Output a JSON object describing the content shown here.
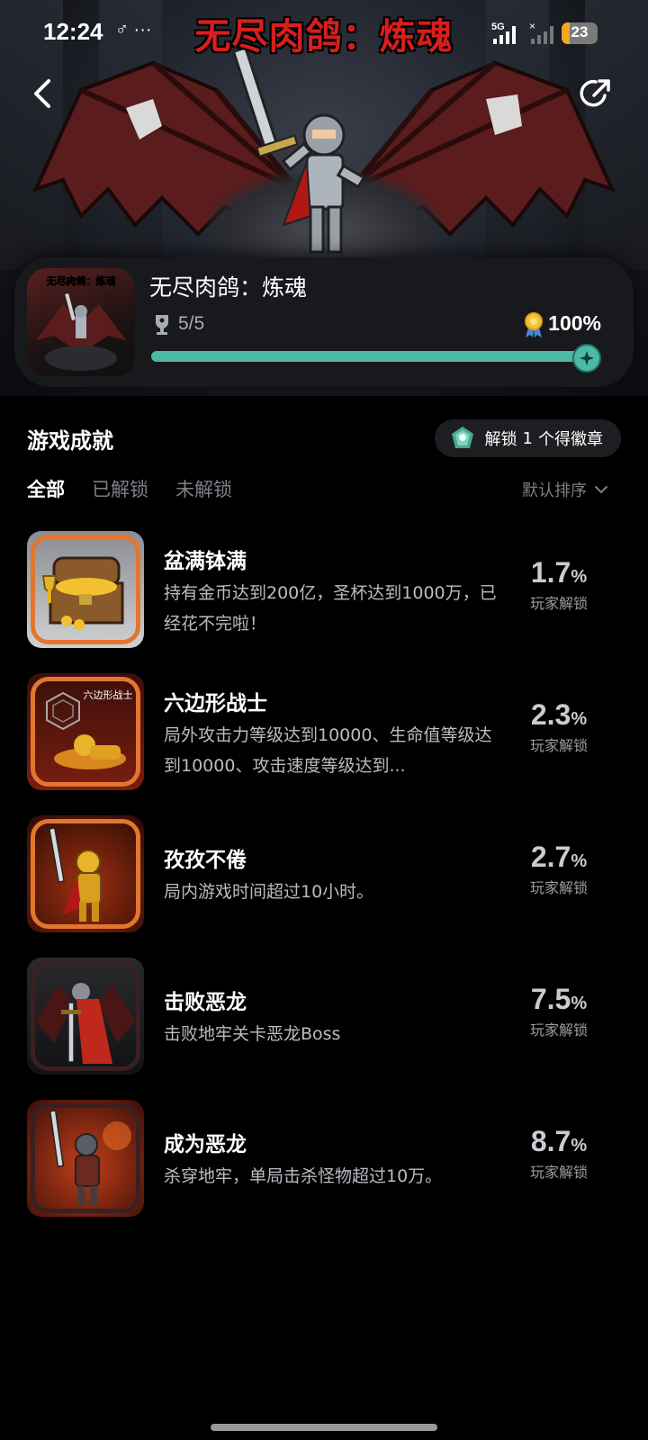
{
  "status_bar": {
    "time": "12:24",
    "extra": "♂ ···",
    "network": "5G",
    "battery": "23"
  },
  "hero": {
    "title": "无尽肉鸽：炼魂"
  },
  "game": {
    "name": "无尽肉鸽：炼魂",
    "icon_title": "无尽肉鸽：炼魂",
    "trophy_count": "5/5",
    "completion": "100%",
    "progress": 1.0
  },
  "section": {
    "title": "游戏成就",
    "badge_prefix": "解锁",
    "badge_count": "1",
    "badge_suffix": "个得徽章"
  },
  "tabs": [
    "全部",
    "已解锁",
    "未解锁"
  ],
  "sort_label": "默认排序",
  "achievements": [
    {
      "name": "盆满钵满",
      "desc": "持有金币达到200亿，圣杯达到1000万，已经花不完啦！",
      "rate": "1.7",
      "pct": "%",
      "label": "玩家解锁"
    },
    {
      "name": "六边形战士",
      "desc": "局外攻击力等级达到10000、生命值等级达到10000、攻击速度等级达到...",
      "rate": "2.3",
      "pct": "%",
      "label": "玩家解锁",
      "img_text": "六边形战士"
    },
    {
      "name": "孜孜不倦",
      "desc": "局内游戏时间超过10小时。",
      "rate": "2.7",
      "pct": "%",
      "label": "玩家解锁"
    },
    {
      "name": "击败恶龙",
      "desc": "击败地牢关卡恶龙Boss",
      "rate": "7.5",
      "pct": "%",
      "label": "玩家解锁"
    },
    {
      "name": "成为恶龙",
      "desc": "杀穿地牢，单局击杀怪物超过10万。",
      "rate": "8.7",
      "pct": "%",
      "label": "玩家解锁"
    }
  ],
  "colors": {
    "accent": "#4db8a6",
    "frame_orange": "#e3762f",
    "title_red": "#d71e1e"
  }
}
